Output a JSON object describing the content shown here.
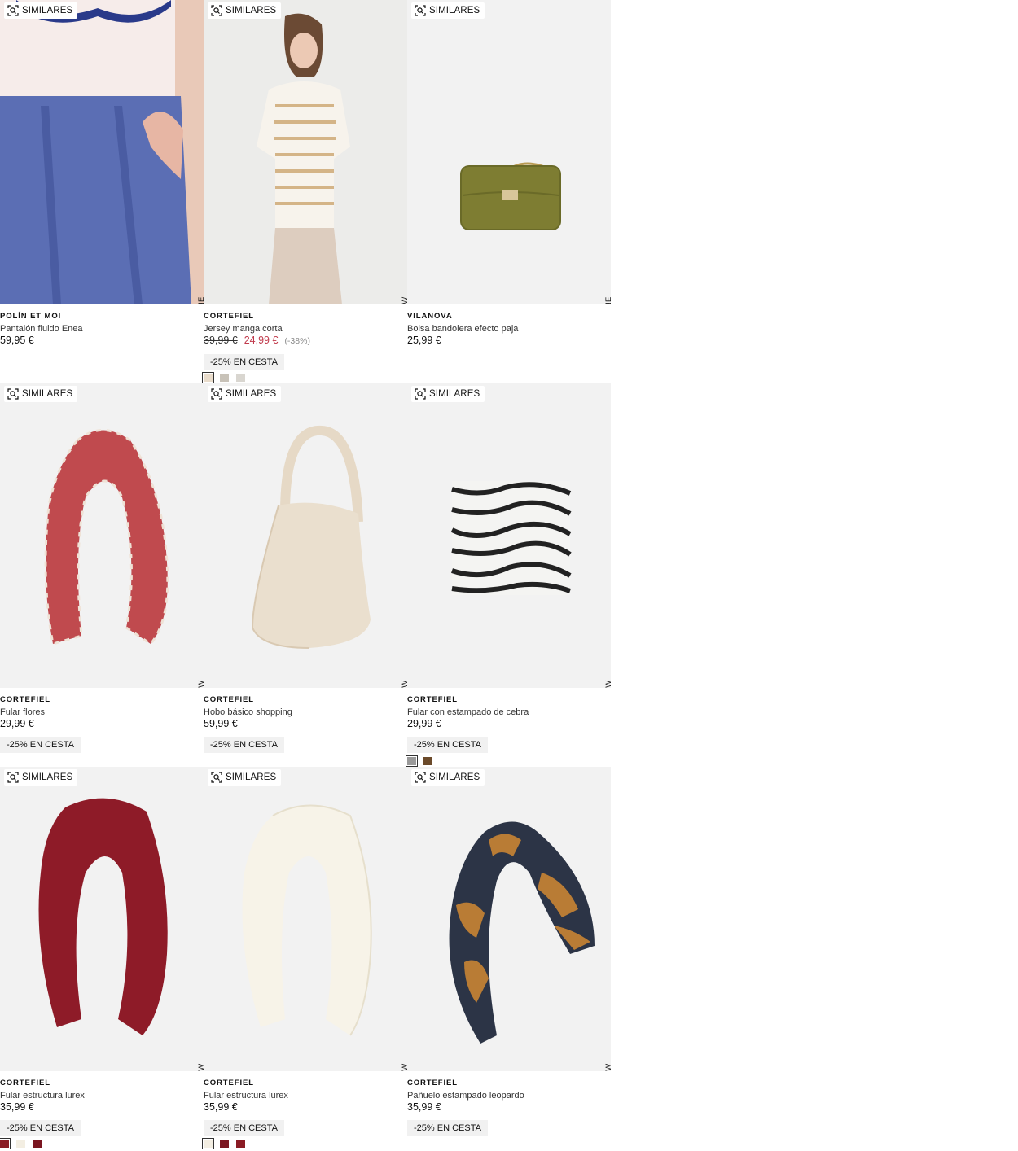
{
  "similar_label": "SIMILARES",
  "products": [
    {
      "brand": "POLÍN ET MOI",
      "name": "Pantalón fluido Enea",
      "price": "59,95 €",
      "old_price": "",
      "sale_price": "",
      "discount_pct": "",
      "promo": "",
      "tag": "NEW / EXCLUSIVO ONLINE",
      "swatches": []
    },
    {
      "brand": "CORTEFIEL",
      "name": "Jersey manga corta",
      "price": "",
      "old_price": "39,99 €",
      "sale_price": "24,99 €",
      "discount_pct": "(-38%)",
      "promo": "-25% EN CESTA",
      "tag": "NEW",
      "swatches": [
        "#e9dccb",
        "#c8c2b8",
        "#d9d6d0"
      ]
    },
    {
      "brand": "VILANOVA",
      "name": "Bolsa bandolera efecto paja",
      "price": "25,99 €",
      "old_price": "",
      "sale_price": "",
      "discount_pct": "",
      "promo": "",
      "tag": "NEW / EXCLUSIVO ONLINE",
      "swatches": []
    },
    {
      "brand": "CORTEFIEL",
      "name": "Fular flores",
      "price": "29,99 €",
      "old_price": "",
      "sale_price": "",
      "discount_pct": "",
      "promo": "-25% EN CESTA",
      "tag": "NEW",
      "swatches": []
    },
    {
      "brand": "CORTEFIEL",
      "name": "Hobo básico shopping",
      "price": "59,99 €",
      "old_price": "",
      "sale_price": "",
      "discount_pct": "",
      "promo": "-25% EN CESTA",
      "tag": "NEW",
      "swatches": []
    },
    {
      "brand": "CORTEFIEL",
      "name": "Fular con estampado de cebra",
      "price": "29,99 €",
      "old_price": "",
      "sale_price": "",
      "discount_pct": "",
      "promo": "-25% EN CESTA",
      "tag": "NEW",
      "swatches": [
        "#9a9a9a",
        "#6b4a2a"
      ]
    },
    {
      "brand": "CORTEFIEL",
      "name": "Fular estructura lurex",
      "price": "35,99 €",
      "old_price": "",
      "sale_price": "",
      "discount_pct": "",
      "promo": "-25% EN CESTA",
      "tag": "NEW",
      "swatches": [
        "#8a1b24",
        "#f3eee2",
        "#7a1520"
      ]
    },
    {
      "brand": "CORTEFIEL",
      "name": "Fular estructura lurex",
      "price": "35,99 €",
      "old_price": "",
      "sale_price": "",
      "discount_pct": "",
      "promo": "-25% EN CESTA",
      "tag": "NEW",
      "swatches": [
        "#f3eee2",
        "#7a1520",
        "#8a1b24"
      ]
    },
    {
      "brand": "CORTEFIEL",
      "name": "Pañuelo estampado leopardo",
      "price": "35,99 €",
      "old_price": "",
      "sale_price": "",
      "discount_pct": "",
      "promo": "-25% EN CESTA",
      "tag": "NEW",
      "swatches": []
    }
  ]
}
